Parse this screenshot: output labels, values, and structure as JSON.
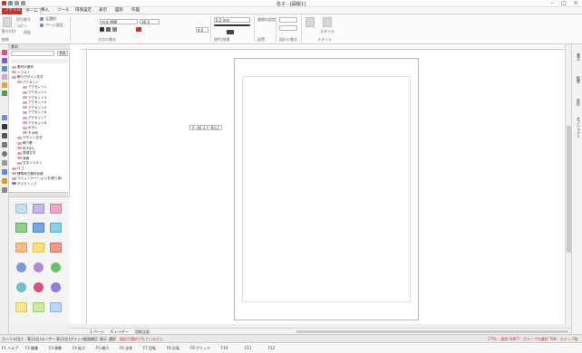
{
  "window": {
    "title": "名子 - [図版1]"
  },
  "tabs": [
    "ファイル",
    "ホーム",
    "挿入",
    "ツール",
    "環境設定",
    "表示",
    "図形",
    "作図"
  ],
  "ribbon": {
    "paste_label": "貼り付け",
    "cut_label": "切り取り",
    "copy_label": "コピー",
    "clear_label": "消去",
    "select_all_label": "全選択",
    "page_settings_label": "ページ設定",
    "font_name": "ＭＳ 明朝",
    "font_size": "36.0",
    "line_width": "0.2 mm",
    "spacing_value": "4.0",
    "style_label": "スタイル",
    "coords_toggle": "座標の設定",
    "groups": [
      "編集",
      "文字の書式",
      "線色/線種",
      "配置",
      "図形の書式",
      "スタイル"
    ]
  },
  "panel": {
    "header": "素材",
    "search_button": "検索",
    "tree": [
      {
        "label": "素材の操作",
        "level": 0,
        "kind": "folder"
      },
      {
        "label": "イラスト",
        "level": 0,
        "kind": "folder"
      },
      {
        "label": "飾りデザイン文字",
        "level": 0,
        "kind": "folder"
      },
      {
        "label": "アクセント",
        "level": 1,
        "kind": "folder"
      },
      {
        "label": "アクセント1",
        "level": 2,
        "kind": "folder"
      },
      {
        "label": "アクセント2",
        "level": 2,
        "kind": "folder"
      },
      {
        "label": "アクセント3",
        "level": 2,
        "kind": "folder"
      },
      {
        "label": "アクセント4",
        "level": 2,
        "kind": "folder"
      },
      {
        "label": "アクセント5",
        "level": 2,
        "kind": "folder"
      },
      {
        "label": "アクセント6",
        "level": 2,
        "kind": "folder"
      },
      {
        "label": "アクセント7",
        "level": 2,
        "kind": "folder"
      },
      {
        "label": "アクセント8",
        "level": 2,
        "kind": "folder"
      },
      {
        "label": "ボタン",
        "level": 2,
        "kind": "folder"
      },
      {
        "label": "その他",
        "level": 2,
        "kind": "folder"
      },
      {
        "label": "デザイン文字",
        "level": 1,
        "kind": "folder"
      },
      {
        "label": "飾り罫",
        "level": 1,
        "kind": "folder"
      },
      {
        "label": "吹き出し",
        "level": 1,
        "kind": "folder"
      },
      {
        "label": "表現文字",
        "level": 1,
        "kind": "folder"
      },
      {
        "label": "背景",
        "level": 1,
        "kind": "folder"
      },
      {
        "label": "文字イラスト",
        "level": 1,
        "kind": "folder"
      },
      {
        "label": "ロゴ",
        "level": 0,
        "kind": "folder"
      },
      {
        "label": "標準地方素材台帳",
        "level": 0,
        "kind": "folder"
      },
      {
        "label": "コミュニケーション(お便り用)",
        "level": 0,
        "kind": "folder"
      },
      {
        "label": "デスクトップ",
        "level": 0,
        "kind": "desktop"
      }
    ]
  },
  "canvas": {
    "coord_tip": "X -66.3  Y -90.2"
  },
  "pagebar": {
    "page_label": "1 ページ",
    "layer_label": "A レイヤー",
    "layer_name": "用紙全面"
  },
  "status": {
    "segments": [
      "カーソル(左)",
      "表示(左)ユーザー",
      "表示(左)グリッド",
      "画面補正",
      "表示",
      "選択",
      "選択オブジェクト"
    ],
    "warning": "図形が選択されていません",
    "hint": "CTRL：連続 SHIFT：グループ内選択 TAB：ステップ取"
  },
  "fnkeys": [
    "F1 ヘルプ",
    "F2 編集",
    "F3 移動",
    "F4 拡大",
    "F5 縮小",
    "F6 全体",
    "F7 回転",
    "F8 反転",
    "F9 グリッド",
    "F10",
    "F11",
    "F12"
  ],
  "colors": {
    "accent": "#c0392b",
    "folder": "#d9a6b9",
    "paper_border": "#b8b8b8"
  }
}
